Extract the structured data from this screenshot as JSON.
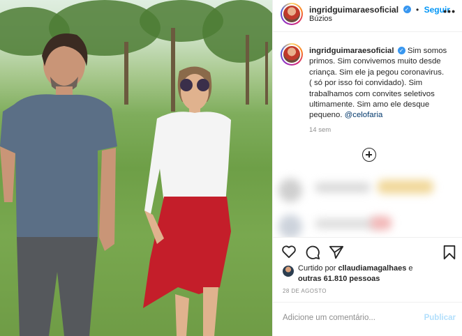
{
  "post": {
    "username": "ingridguimaraesoficial",
    "follow_label": "Seguir",
    "location": "Búzios",
    "caption_text": "Sim somos primos. Sim convivemos muito desde criança. Sim ele ja pegou coronavirus. ( só por isso foi convidado). Sim trabalhamos com convites seletivos ultimamente. Sim amo ele desque pequeno. ",
    "caption_mention": "@celofaria",
    "time_ago": "14 sem",
    "liked_prefix": "Curtido por ",
    "liked_user": "cllaudiamagalhaes",
    "liked_mid": " e",
    "liked_others": "outras 61.810 pessoas",
    "date": "28 DE AGOSTO",
    "comment_placeholder": "Adicione um comentário...",
    "publish_label": "Publicar"
  },
  "icons": {
    "verified": "verified-badge-icon",
    "more": "more-options-icon",
    "like": "heart-icon",
    "comment": "comment-icon",
    "share": "paper-plane-icon",
    "save": "bookmark-icon",
    "load_more": "plus-circle-icon"
  },
  "colors": {
    "link": "#0095f6",
    "verified": "#3897f0",
    "muted": "#8e8e8e",
    "publish_disabled": "#b2dffc"
  }
}
